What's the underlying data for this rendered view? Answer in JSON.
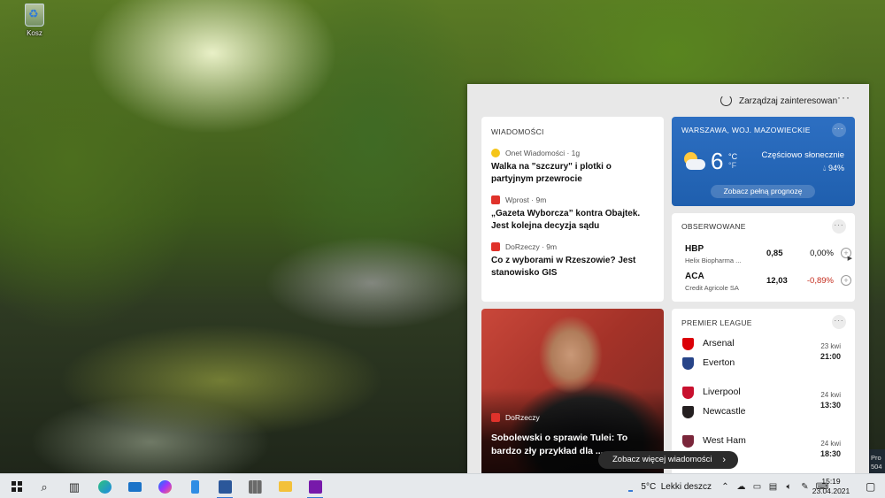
{
  "desktop": {
    "recycle_bin_label": "Kosz"
  },
  "flyout": {
    "manage_interests": "Zarządzaj zainteresowan",
    "news_card": {
      "label": "WIADOMOŚCI",
      "items": [
        {
          "source": "Onet Wiadomości · 1g",
          "headline": "Walka na \"szczury\" i plotki o partyjnym przewrocie"
        },
        {
          "source": "Wprost · 9m",
          "headline": "„Gazeta Wyborcza” kontra Obajtek. Jest kolejna decyzja sądu"
        },
        {
          "source": "DoRzeczy · 9m",
          "headline": "Co z wyborami w Rzeszowie? Jest stanowisko GIS"
        }
      ]
    },
    "weather_card": {
      "location": "WARSZAWA, WOJ. MAZOWIECKIE",
      "temperature": "6",
      "unit_c": "°C",
      "unit_f": "°F",
      "condition": "Częściowo słonecznie",
      "humidity": "94%",
      "forecast_button": "Zobacz pełną prognozę"
    },
    "watch_card": {
      "label": "OBSERWOWANE",
      "stocks": [
        {
          "symbol": "HBP",
          "name": "Helix Biopharma ...",
          "price": "0,85",
          "change": "0,00%"
        },
        {
          "symbol": "ACA",
          "name": "Credit Agricole SA",
          "price": "12,03",
          "change": "-0,89%"
        }
      ]
    },
    "photo_card": {
      "source": "DoRzeczy",
      "headline": "Sobolewski o sprawie Tulei: To bardzo zły przykład dla ..."
    },
    "pl_card": {
      "label": "PREMIER LEAGUE",
      "matches": [
        {
          "home": "Arsenal",
          "away": "Everton",
          "date": "23 kwi",
          "time": "21:00",
          "home_color": "#db0007",
          "away_color": "#274488"
        },
        {
          "home": "Liverpool",
          "away": "Newcastle",
          "date": "24 kwi",
          "time": "13:30",
          "home_color": "#c8102e",
          "away_color": "#241f20"
        },
        {
          "home": "West Ham",
          "away": "",
          "date": "24 kwi",
          "time": "18:30",
          "home_color": "#7a263a",
          "away_color": "#888888"
        }
      ]
    },
    "see_more": "Zobacz więcej wiadomości"
  },
  "edge_window": {
    "line1": "Pro",
    "line2": "504"
  },
  "taskbar": {
    "weather": "5°C  Lekki deszcz",
    "time": "15:19",
    "date": "23.04.2021",
    "apps": [
      "start",
      "search",
      "task-view",
      "edge",
      "mail",
      "messenger",
      "files",
      "word",
      "calculator",
      "file-explorer",
      "onenote"
    ]
  },
  "colors": {
    "weather_bg": "#2565b5",
    "taskbar_bg": "#e6e9ec",
    "negative": "#c42b1c"
  }
}
